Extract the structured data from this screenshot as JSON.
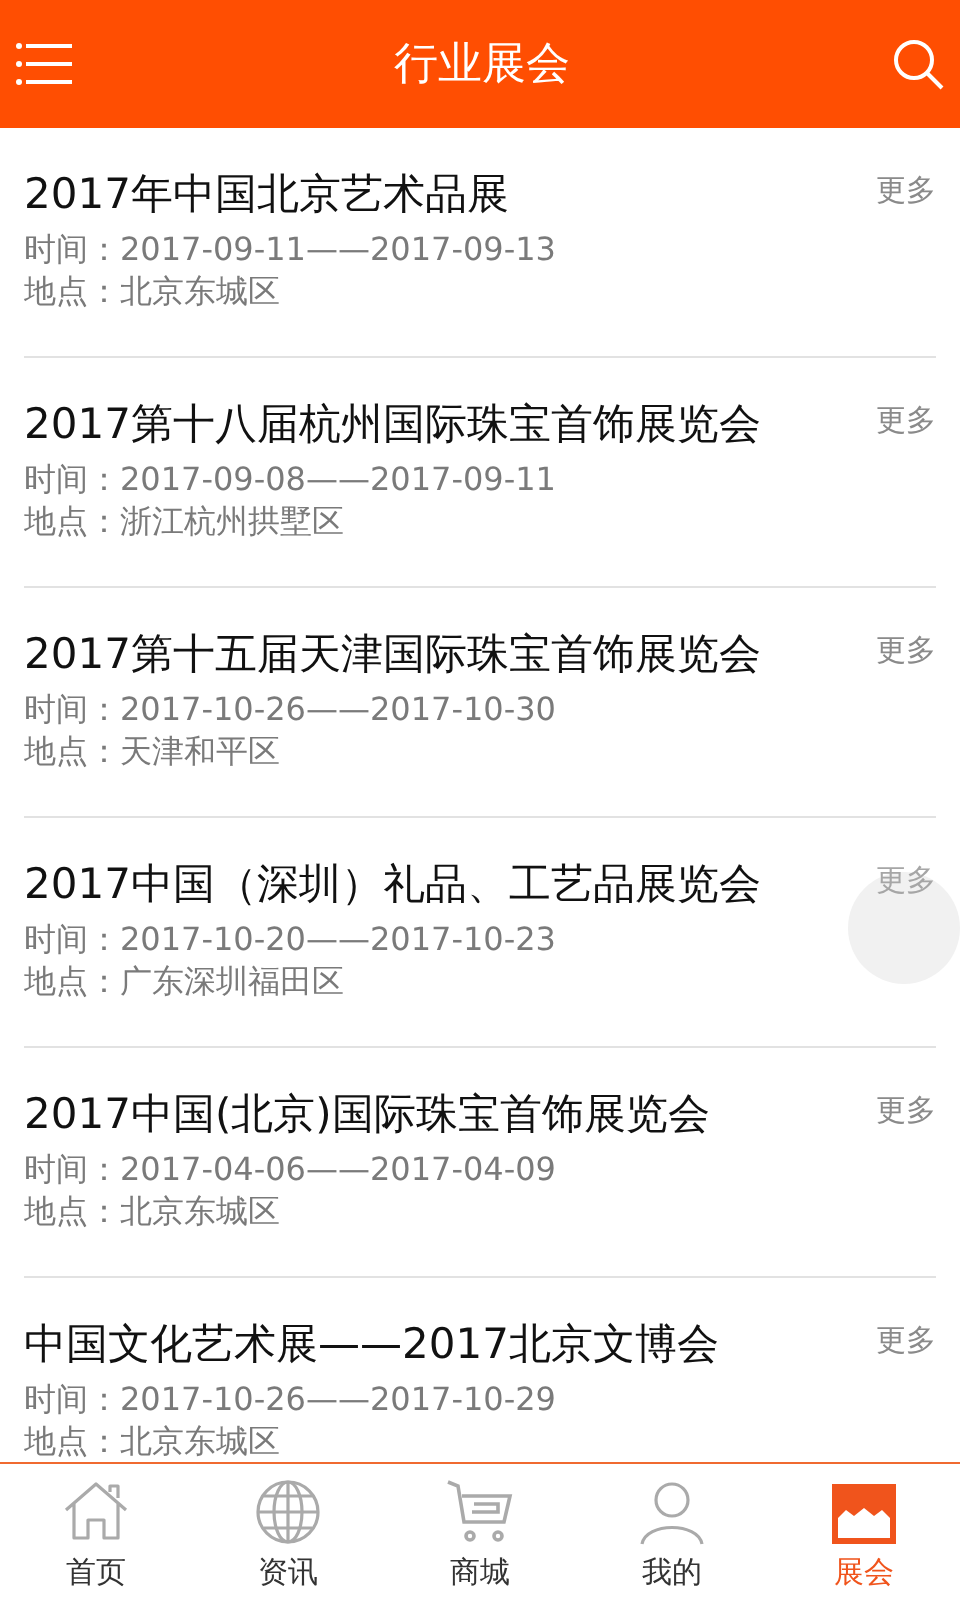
{
  "header": {
    "title": "行业展会"
  },
  "exhibitions": [
    {
      "title": "2017年中国北京艺术品展",
      "time": "时间：2017-09-11——2017-09-13",
      "place": "地点：北京东城区",
      "more": "更多",
      "pressed": false
    },
    {
      "title": "2017第十八届杭州国际珠宝首饰展览会",
      "time": "时间：2017-09-08——2017-09-11",
      "place": "地点：浙江杭州拱墅区",
      "more": "更多",
      "pressed": false
    },
    {
      "title": "2017第十五届天津国际珠宝首饰展览会",
      "time": "时间：2017-10-26——2017-10-30",
      "place": "地点：天津和平区",
      "more": "更多",
      "pressed": false
    },
    {
      "title": "2017中国（深圳）礼品、工艺品展览会",
      "time": "时间：2017-10-20——2017-10-23",
      "place": "地点：广东深圳福田区",
      "more": "更多",
      "pressed": true
    },
    {
      "title": "2017中国(北京)国际珠宝首饰展览会",
      "time": "时间：2017-04-06——2017-04-09",
      "place": "地点：北京东城区",
      "more": "更多",
      "pressed": false
    },
    {
      "title": "中国文化艺术展——2017北京文博会",
      "time": "时间：2017-10-26——2017-10-29",
      "place": "地点：北京东城区",
      "more": "更多",
      "pressed": false
    }
  ],
  "tabbar": [
    {
      "kind": "home",
      "label": "首页",
      "selected": false
    },
    {
      "kind": "globe",
      "label": "资讯",
      "selected": false
    },
    {
      "kind": "cart",
      "label": "商城",
      "selected": false
    },
    {
      "kind": "person",
      "label": "我的",
      "selected": false
    },
    {
      "kind": "store",
      "label": "展会",
      "selected": true
    }
  ]
}
